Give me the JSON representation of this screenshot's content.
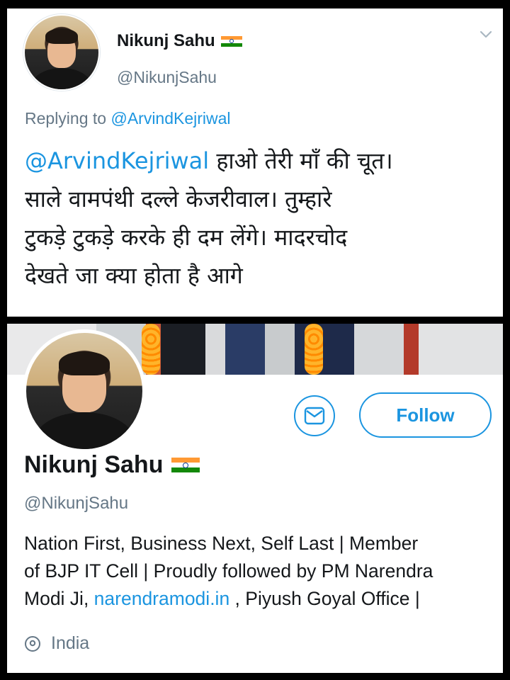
{
  "tweet": {
    "author_name": "Nikunj Sahu",
    "author_handle": "@NikunjSahu",
    "replying_prefix": "Replying to",
    "replying_to": "@ArvindKejriwal",
    "mention": "@ArvindKejriwal",
    "text_line1_rest": " हाओ तेरी माँ की चूत।",
    "text_line2": "साले वामपंथी दल्ले केजरीवाल। तुम्हारे",
    "text_line3": "टुकड़े टुकड़े करके ही दम लेंगे। मादरचोद",
    "text_line4": "देखते जा क्या होता है आगे"
  },
  "profile": {
    "name": "Nikunj Sahu",
    "handle": "@NikunjSahu",
    "follow_label": "Follow",
    "bio_line1": "Nation First, Business Next, Self Last | Member",
    "bio_line2": "of BJP IT Cell | Proudly followed by PM Narendra",
    "bio_line3_prefix": "Modi Ji, ",
    "bio_link": "narendramodi.in",
    "bio_line3_suffix": " , Piyush Goyal Office |",
    "location": "India"
  },
  "icons": {
    "flag": "india-flag-icon",
    "chevron": "chevron-down-icon",
    "message": "envelope-icon",
    "location": "location-pin-icon"
  },
  "colors": {
    "accent": "#1b95e0",
    "text": "#14171a",
    "secondary": "#657786",
    "saffron": "#ff9933",
    "green": "#138808"
  }
}
